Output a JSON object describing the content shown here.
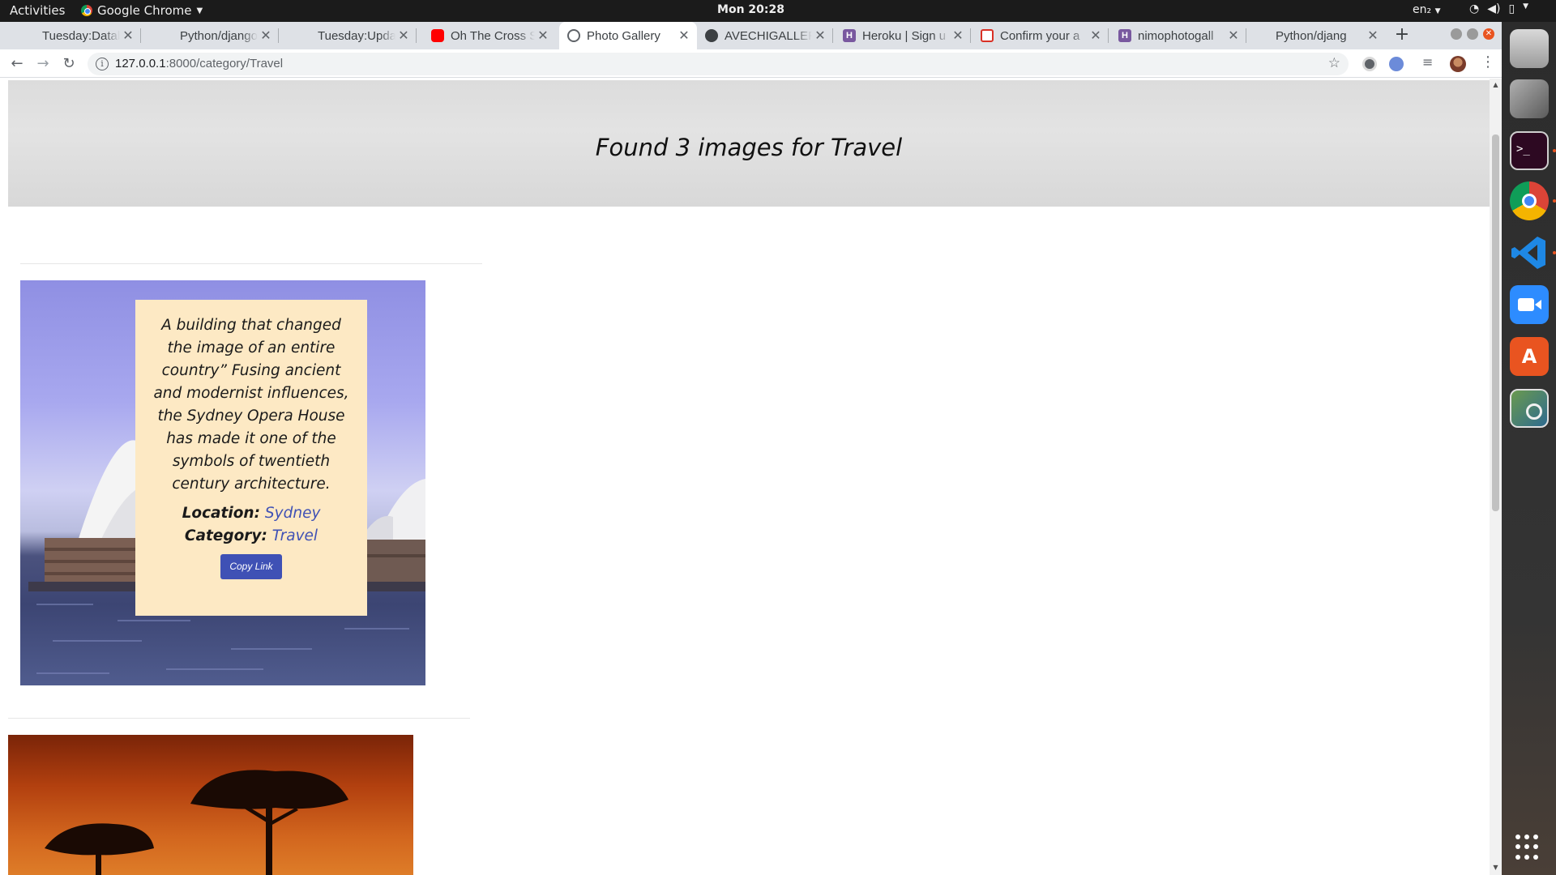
{
  "topbar": {
    "activities": "Activities",
    "app_name": "Google Chrome",
    "clock": "Mon 20:28",
    "lang": "en₂"
  },
  "tabs": [
    {
      "title": "Tuesday:Datab",
      "favicon": "dot-icon"
    },
    {
      "title": "Python/django",
      "favicon": "dot-icon"
    },
    {
      "title": "Tuesday:Updat",
      "favicon": "dot-icon"
    },
    {
      "title": "Oh The Cross Sp",
      "favicon": "youtube-icon"
    },
    {
      "title": "Photo Gallery",
      "favicon": "globe-icon",
      "active": true
    },
    {
      "title": "AVECHIGALLER",
      "favicon": "github-icon"
    },
    {
      "title": "Heroku | Sign u",
      "favicon": "heroku-icon"
    },
    {
      "title": "Confirm your a",
      "favicon": "gmail-icon"
    },
    {
      "title": "nimophotogall",
      "favicon": "heroku-icon"
    },
    {
      "title": "Python/djang",
      "favicon": "dot-icon"
    }
  ],
  "address": {
    "host": "127.0.0.1",
    "path": ":8000/category/Travel"
  },
  "page": {
    "heading": "Found 3 images for Travel",
    "items": [
      {
        "description": "A building that changed the image of an entire country” Fusing ancient and modernist influences, the Sydney Opera House has made it one of the symbols of twentieth century architecture.",
        "location_label": "Location:",
        "location": "Sydney",
        "category_label": "Category:",
        "category": "Travel",
        "copy_button": "Copy Link"
      }
    ]
  },
  "dock": [
    "files-icon",
    "settings-icon",
    "terminal-icon",
    "chrome-icon",
    "vscode-icon",
    "zoom-icon",
    "software-center-icon",
    "image-viewer-icon",
    "show-apps-icon"
  ],
  "colors": {
    "accent": "#3f51b5",
    "caption_bg": "#fde9c4",
    "ubuntu_orange": "#e95420"
  }
}
